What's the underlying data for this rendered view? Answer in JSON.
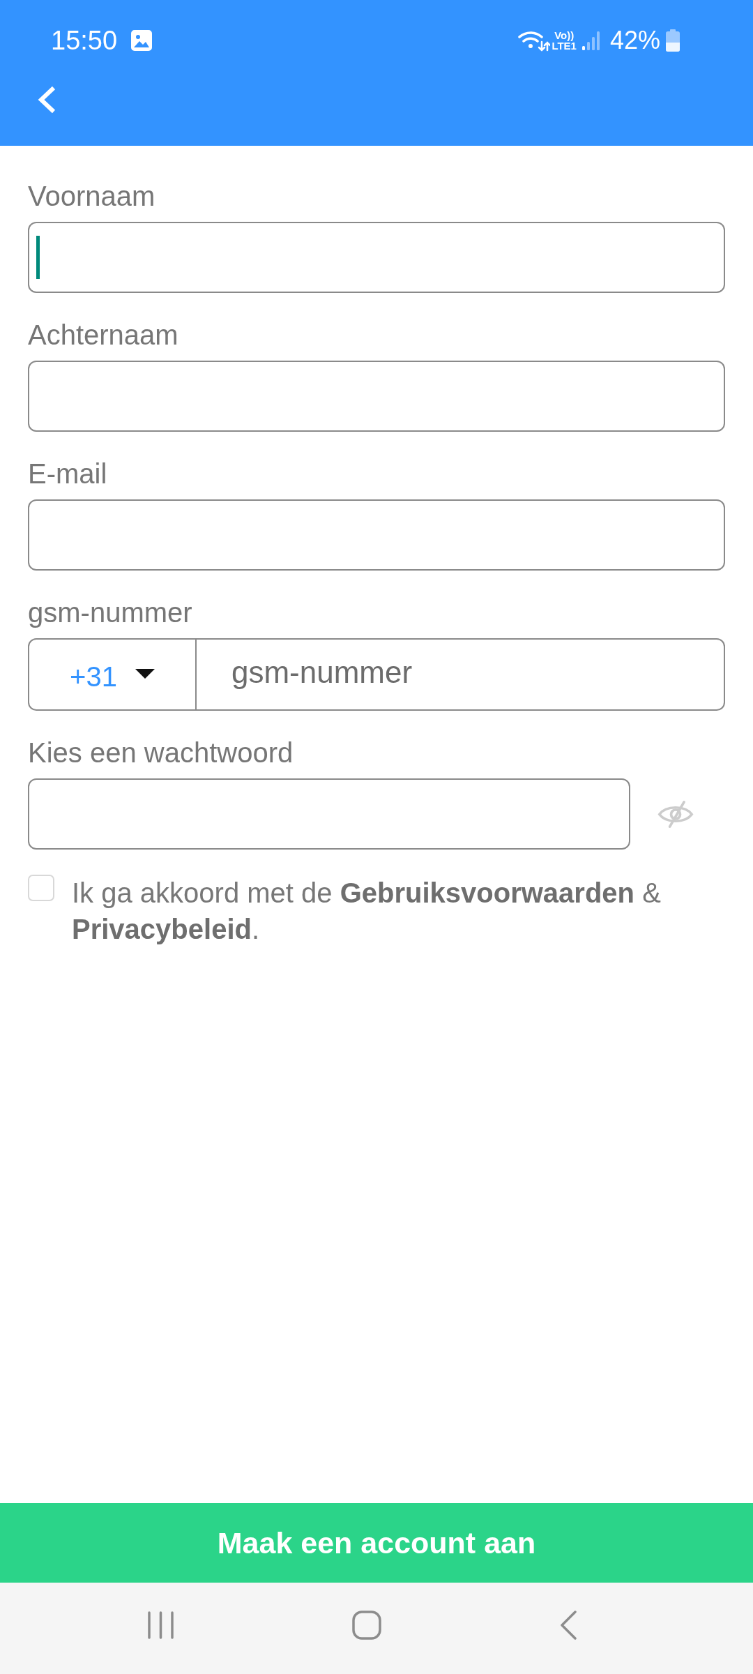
{
  "status_bar": {
    "time": "15:50",
    "volte": "Vo))",
    "network": "LTE1",
    "battery": "42%"
  },
  "fields": [
    {
      "kind": "text",
      "label": "Voornaam",
      "focused": true
    },
    {
      "kind": "text",
      "label": "Achternaam",
      "focused": false
    },
    {
      "kind": "text",
      "label": "E-mail",
      "focused": false
    },
    {
      "kind": "phone",
      "label": "gsm-nummer",
      "country_code": "+31",
      "placeholder": "gsm-nummer",
      "focused": false
    },
    {
      "kind": "password",
      "label": "Kies een wachtwoord",
      "focused": false
    }
  ],
  "agreement": {
    "checked": false,
    "text": "Ik ga akkoord met de **Gebruiksvoorwaarden** & **Privacybeleid**."
  },
  "submit_button": {
    "label": "Maak een account aan"
  }
}
